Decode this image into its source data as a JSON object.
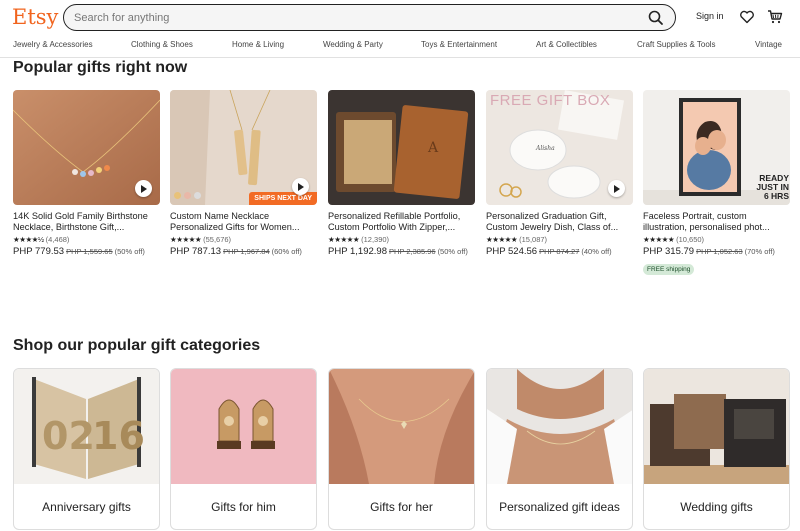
{
  "header": {
    "logo": "Etsy",
    "search_placeholder": "Search for anything",
    "sign_in": "Sign in"
  },
  "categories": [
    "Jewelry & Accessories",
    "Clothing & Shoes",
    "Home & Living",
    "Wedding & Party",
    "Toys & Entertainment",
    "Art & Collectibles",
    "Craft Supplies & Tools",
    "Vintage"
  ],
  "popular": {
    "title": "Popular gifts right now",
    "products": [
      {
        "title": "14K Solid Gold Family Birthstone Necklace, Birthstone Gift,...",
        "stars": "★★★★½",
        "reviews": "(4,468)",
        "price": "PHP 779.53",
        "original": "PHP 1,559.65",
        "discount": "(50% off)"
      },
      {
        "title": "Custom Name Necklace Personalized Gifts for Women...",
        "stars": "★★★★★",
        "reviews": "(55,676)",
        "price": "PHP 787.13",
        "original": "PHP 1,967.84",
        "discount": "(60% off)",
        "badge": "SHIPS NEXT DAY"
      },
      {
        "title": "Personalized Refillable Portfolio, Custom Portfolio With Zipper,...",
        "stars": "★★★★★",
        "reviews": "(12,390)",
        "price": "PHP 1,192.98",
        "original": "PHP 2,385.96",
        "discount": "(50% off)"
      },
      {
        "title": "Personalized Graduation Gift, Custom Jewelry Dish, Class of...",
        "stars": "★★★★★",
        "reviews": "(15,087)",
        "price": "PHP 524.56",
        "original": "PHP 874.27",
        "discount": "(40% off)",
        "image_text": "FREE GIFT BOX"
      },
      {
        "title": "Faceless Portrait, custom illustration, personalised phot...",
        "stars": "★★★★★",
        "reviews": "(10,650)",
        "price": "PHP 315.79",
        "original": "PHP 1,052.63",
        "discount": "(70% off)",
        "free_shipping": "FREE shipping",
        "image_text": "READY JUST IN 6 HRS"
      }
    ]
  },
  "gift_categories": {
    "title": "Shop our popular gift categories",
    "items": [
      "Anniversary gifts",
      "Gifts for him",
      "Gifts for her",
      "Personalized gift ideas",
      "Wedding gifts"
    ]
  },
  "colors": {
    "brand": "#f1641e",
    "badge": "#f26b24",
    "free_shipping_bg": "#d4e9d7"
  }
}
